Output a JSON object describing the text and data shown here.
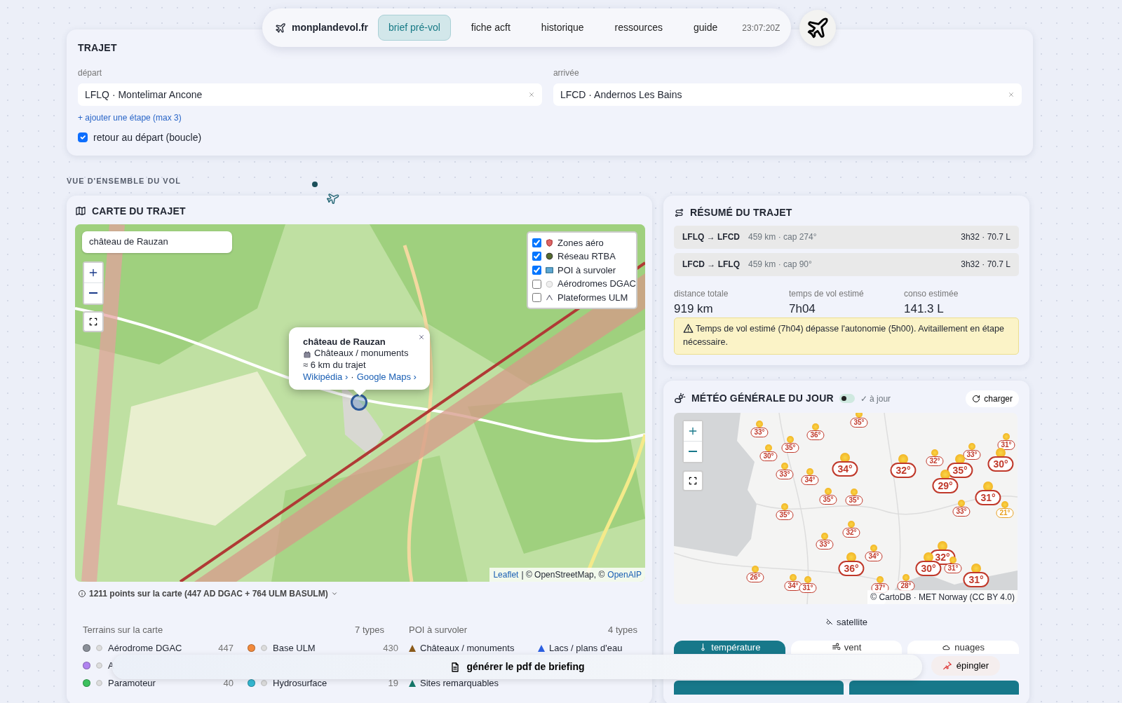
{
  "nav": {
    "brand": "monplandevol.fr",
    "tabs": [
      {
        "label": "brief pré-vol",
        "selected": true
      },
      {
        "label": "fiche acft",
        "selected": false
      },
      {
        "label": "historique",
        "selected": false
      },
      {
        "label": "ressources",
        "selected": false
      },
      {
        "label": "guide",
        "selected": false
      }
    ],
    "time": "23:07:20Z"
  },
  "trajet": {
    "title": "TRAJET",
    "fields": [
      {
        "label": "départ",
        "value": "LFLQ · Montelimar Ancone"
      },
      {
        "label": "arrivée",
        "value": "LFCD · Andernos Les Bains"
      }
    ],
    "add_stop": "+ ajouter une étape (max 3)",
    "loop": {
      "label": "retour au départ (boucle)",
      "checked": true
    }
  },
  "section_label": "VUE D'ENSEMBLE DU VOL",
  "map_card": {
    "title": "CARTE DU TRAJET",
    "search": {
      "value": "château de Rauzan"
    },
    "layers": [
      {
        "label": "Zones aéro",
        "checked": true
      },
      {
        "label": "Réseau RTBA",
        "checked": true
      },
      {
        "label": "POI à survoler",
        "checked": true
      },
      {
        "label": "Aérodromes DGAC",
        "checked": false
      },
      {
        "label": "Plateformes ULM",
        "checked": false
      }
    ],
    "popup": {
      "title": "château de Rauzan",
      "category": "Châteaux / monuments",
      "distance": "≈ 6 km du trajet",
      "links": [
        "Wikipédia ›",
        "Google Maps ›"
      ],
      "separator": "·"
    },
    "attribution": [
      {
        "text": "Leaflet",
        "link": true
      },
      {
        "text": "| © OpenStreetMap, ©",
        "link": false
      },
      {
        "text": "OpenAIP",
        "link": true
      }
    ],
    "points_note": "1211 points sur la carte (447 AD DGAC + 764 ULM BASULM)",
    "terrains": {
      "title": "Terrains sur la carte",
      "count": "7 types",
      "items": [
        {
          "label": "Aérodrome DGAC",
          "count": "447",
          "color": "#8a8f98"
        },
        {
          "label": "Base ULM",
          "count": "430",
          "color": "#f28a3c"
        },
        {
          "label": "A",
          "color": "#b083f0"
        },
        {
          "label": "Paramoteur",
          "count": "40",
          "color": "#3cc05e"
        },
        {
          "label": "Hydrosurface",
          "count": "19",
          "color": "#35b9d3"
        }
      ]
    },
    "poi": {
      "title": "POI à survoler",
      "count": "4 types",
      "items": [
        {
          "label": "Châteaux / monuments",
          "color": "#8a5a1a"
        },
        {
          "label": "Lacs / plans d'eau",
          "color": "#2a5ee0"
        },
        {
          "label": "Sites remarquables",
          "color": "#16786a"
        }
      ]
    }
  },
  "summary": {
    "title": "RÉSUMÉ DU TRAJET",
    "legs": [
      {
        "route": "LFLQ → LFCD",
        "detail": "459 km · cap 274°",
        "time": "3h32 · 70.7 L"
      },
      {
        "route": "LFCD → LFLQ",
        "detail": "459 km · cap 90°",
        "time": "3h32 · 70.7 L"
      }
    ],
    "stats": [
      {
        "label": "distance totale",
        "value": "919 km"
      },
      {
        "label": "temps de vol estimé",
        "value": "7h04"
      },
      {
        "label": "conso estimée",
        "value": "141.3 L"
      }
    ],
    "warning": "Temps de vol estimé (7h04) dépasse l'autonomie (5h00). Avitaillement en étape nécessaire."
  },
  "meteo": {
    "title": "MÉTÉO GÉNÉRALE DU JOUR",
    "toggle": {
      "on": false
    },
    "status": "✓ à jour",
    "reload": "charger",
    "markers": [
      {
        "temp": "35°",
        "kind": "minor",
        "color": "#c0392b"
      },
      {
        "temp": "33°",
        "kind": "minor",
        "color": "#c0392b"
      },
      {
        "temp": "36°",
        "kind": "minor",
        "color": "#c0392b"
      },
      {
        "temp": "35°",
        "kind": "minor",
        "color": "#c0392b"
      },
      {
        "temp": "31°",
        "kind": "minor",
        "color": "#c0392b"
      },
      {
        "temp": "30°",
        "kind": "minor",
        "color": "#c0392b"
      },
      {
        "temp": "33°",
        "kind": "minor",
        "color": "#c0392b"
      },
      {
        "temp": "32°",
        "kind": "minor",
        "color": "#c0392b"
      },
      {
        "temp": "30°",
        "kind": "city",
        "color": "#c0392b"
      },
      {
        "temp": "34°",
        "kind": "city",
        "color": "#c0392b"
      },
      {
        "temp": "32°",
        "kind": "city",
        "color": "#c0392b"
      },
      {
        "temp": "35°",
        "kind": "city",
        "color": "#c0392b"
      },
      {
        "temp": "33°",
        "kind": "minor",
        "color": "#c0392b"
      },
      {
        "temp": "34°",
        "kind": "minor",
        "color": "#c0392b"
      },
      {
        "temp": "29°",
        "kind": "city",
        "color": "#c0392b"
      },
      {
        "temp": "35°",
        "kind": "minor",
        "color": "#c0392b"
      },
      {
        "temp": "35°",
        "kind": "minor",
        "color": "#c0392b"
      },
      {
        "temp": "31°",
        "kind": "city",
        "color": "#c0392b"
      },
      {
        "temp": "35°",
        "kind": "minor",
        "color": "#c0392b"
      },
      {
        "temp": "33°",
        "kind": "minor",
        "color": "#c0392b"
      },
      {
        "temp": "21°",
        "kind": "minor",
        "color": "#e8a020"
      },
      {
        "temp": "32°",
        "kind": "minor",
        "color": "#c0392b"
      },
      {
        "temp": "33°",
        "kind": "minor",
        "color": "#c0392b"
      },
      {
        "temp": "34°",
        "kind": "minor",
        "color": "#c0392b"
      },
      {
        "temp": "32°",
        "kind": "city",
        "color": "#c0392b"
      },
      {
        "temp": "36°",
        "kind": "city",
        "color": "#c0392b"
      },
      {
        "temp": "30°",
        "kind": "city",
        "color": "#c0392b"
      },
      {
        "temp": "31°",
        "kind": "minor",
        "color": "#c0392b"
      },
      {
        "temp": "26°",
        "kind": "minor",
        "color": "#c0392b"
      },
      {
        "temp": "31°",
        "kind": "city",
        "color": "#c0392b"
      },
      {
        "temp": "34°",
        "kind": "minor",
        "color": "#c0392b"
      },
      {
        "temp": "31°",
        "kind": "minor",
        "color": "#c0392b"
      },
      {
        "temp": "37°",
        "kind": "minor",
        "color": "#c0392b"
      },
      {
        "temp": "28°",
        "kind": "minor",
        "color": "#c0392b"
      }
    ],
    "attribution": "© CartoDB · MET Norway (CC BY 4.0)",
    "satellite": "satellite",
    "tabs": [
      {
        "label": "température",
        "selected": true
      },
      {
        "label": "vent",
        "selected": false
      },
      {
        "label": "nuages",
        "selected": false
      }
    ],
    "pin": "épingler"
  },
  "pdf_bar": "générer le pdf de briefing"
}
